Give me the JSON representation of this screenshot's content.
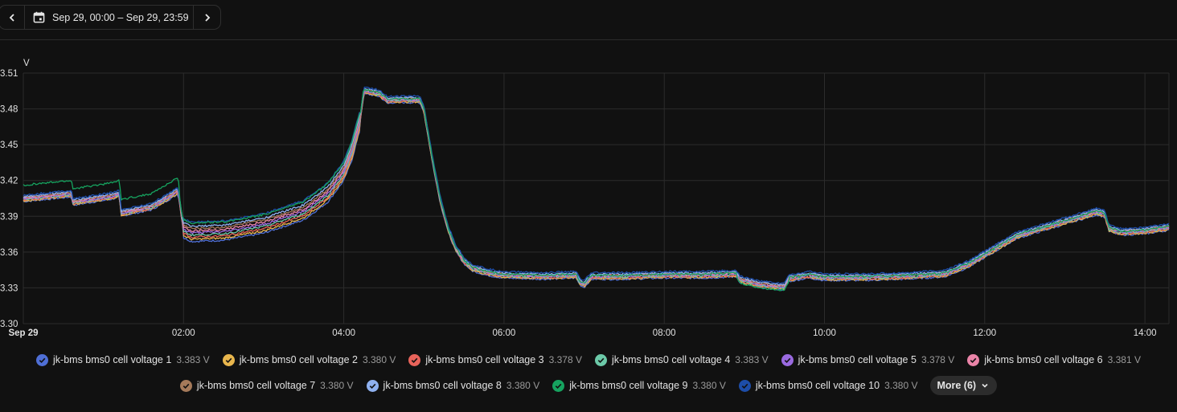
{
  "toolbar": {
    "prev_icon": "chevron-left-icon",
    "next_icon": "chevron-right-icon",
    "calendar_icon": "calendar-icon",
    "date_range": "Sep 29, 00:00 – Sep 29, 23:59"
  },
  "chart_data": {
    "type": "line",
    "ylabel": "V",
    "ylim": [
      3.3,
      3.51
    ],
    "yticks": [
      "3.30",
      "3.33",
      "3.36",
      "3.39",
      "3.42",
      "3.45",
      "3.48",
      "3.51"
    ],
    "xlim": [
      0,
      14.3
    ],
    "xticks": [
      {
        "x": 0,
        "label": "Sep 29"
      },
      {
        "x": 2,
        "label": "02:00"
      },
      {
        "x": 4,
        "label": "04:00"
      },
      {
        "x": 6,
        "label": "06:00"
      },
      {
        "x": 8,
        "label": "08:00"
      },
      {
        "x": 10,
        "label": "10:00"
      },
      {
        "x": 12,
        "label": "12:00"
      },
      {
        "x": 14,
        "label": "14:00"
      }
    ],
    "grid": true,
    "base_curve": [
      [
        0.0,
        3.405
      ],
      [
        0.6,
        3.409
      ],
      [
        0.62,
        3.402
      ],
      [
        1.1,
        3.407
      ],
      [
        1.2,
        3.409
      ],
      [
        1.22,
        3.393
      ],
      [
        1.6,
        3.398
      ],
      [
        1.9,
        3.41
      ],
      [
        1.93,
        3.412
      ],
      [
        2.0,
        3.38
      ],
      [
        2.1,
        3.377
      ],
      [
        2.5,
        3.378
      ],
      [
        3.0,
        3.384
      ],
      [
        3.5,
        3.395
      ],
      [
        3.8,
        3.41
      ],
      [
        4.0,
        3.428
      ],
      [
        4.1,
        3.445
      ],
      [
        4.2,
        3.47
      ],
      [
        4.25,
        3.495
      ],
      [
        4.3,
        3.495
      ],
      [
        4.45,
        3.493
      ],
      [
        4.55,
        3.487
      ],
      [
        4.6,
        3.488
      ],
      [
        4.95,
        3.488
      ],
      [
        5.0,
        3.48
      ],
      [
        5.1,
        3.44
      ],
      [
        5.2,
        3.405
      ],
      [
        5.3,
        3.38
      ],
      [
        5.4,
        3.363
      ],
      [
        5.5,
        3.353
      ],
      [
        5.6,
        3.347
      ],
      [
        5.8,
        3.343
      ],
      [
        6.0,
        3.341
      ],
      [
        6.5,
        3.34
      ],
      [
        6.9,
        3.341
      ],
      [
        6.95,
        3.335
      ],
      [
        7.0,
        3.333
      ],
      [
        7.05,
        3.337
      ],
      [
        7.1,
        3.34
      ],
      [
        7.5,
        3.34
      ],
      [
        8.0,
        3.341
      ],
      [
        8.5,
        3.341
      ],
      [
        8.9,
        3.342
      ],
      [
        8.95,
        3.337
      ],
      [
        9.2,
        3.333
      ],
      [
        9.5,
        3.331
      ],
      [
        9.55,
        3.338
      ],
      [
        9.8,
        3.341
      ],
      [
        10.0,
        3.339
      ],
      [
        10.5,
        3.339
      ],
      [
        11.0,
        3.34
      ],
      [
        11.5,
        3.342
      ],
      [
        11.8,
        3.35
      ],
      [
        12.0,
        3.358
      ],
      [
        12.2,
        3.366
      ],
      [
        12.4,
        3.374
      ],
      [
        12.8,
        3.382
      ],
      [
        13.2,
        3.39
      ],
      [
        13.4,
        3.394
      ],
      [
        13.5,
        3.392
      ],
      [
        13.55,
        3.38
      ],
      [
        13.7,
        3.377
      ],
      [
        14.0,
        3.378
      ],
      [
        14.3,
        3.381
      ]
    ],
    "series": [
      {
        "name": "jk-bms bms0 cell voltage 1",
        "color": "#4f6fd6",
        "value": "3.383 V"
      },
      {
        "name": "jk-bms bms0 cell voltage 2",
        "color": "#e8b64d",
        "value": "3.380 V"
      },
      {
        "name": "jk-bms bms0 cell voltage 3",
        "color": "#e8635a",
        "value": "3.378 V"
      },
      {
        "name": "jk-bms bms0 cell voltage 4",
        "color": "#6cc9a8",
        "value": "3.383 V"
      },
      {
        "name": "jk-bms bms0 cell voltage 5",
        "color": "#9a6ae0",
        "value": "3.378 V"
      },
      {
        "name": "jk-bms bms0 cell voltage 6",
        "color": "#ea84a8",
        "value": "3.381 V"
      },
      {
        "name": "jk-bms bms0 cell voltage 7",
        "color": "#a57a5a",
        "value": "3.380 V"
      },
      {
        "name": "jk-bms bms0 cell voltage 8",
        "color": "#8fb1f0",
        "value": "3.380 V"
      },
      {
        "name": "jk-bms bms0 cell voltage 9",
        "color": "#16a35f",
        "value": "3.380 V"
      },
      {
        "name": "jk-bms bms0 cell voltage 10",
        "color": "#1d4da8",
        "value": "3.380 V"
      }
    ]
  },
  "legend": {
    "check_icon": "check-icon",
    "more_label": "More (6)",
    "more_icon": "chevron-down-icon"
  }
}
